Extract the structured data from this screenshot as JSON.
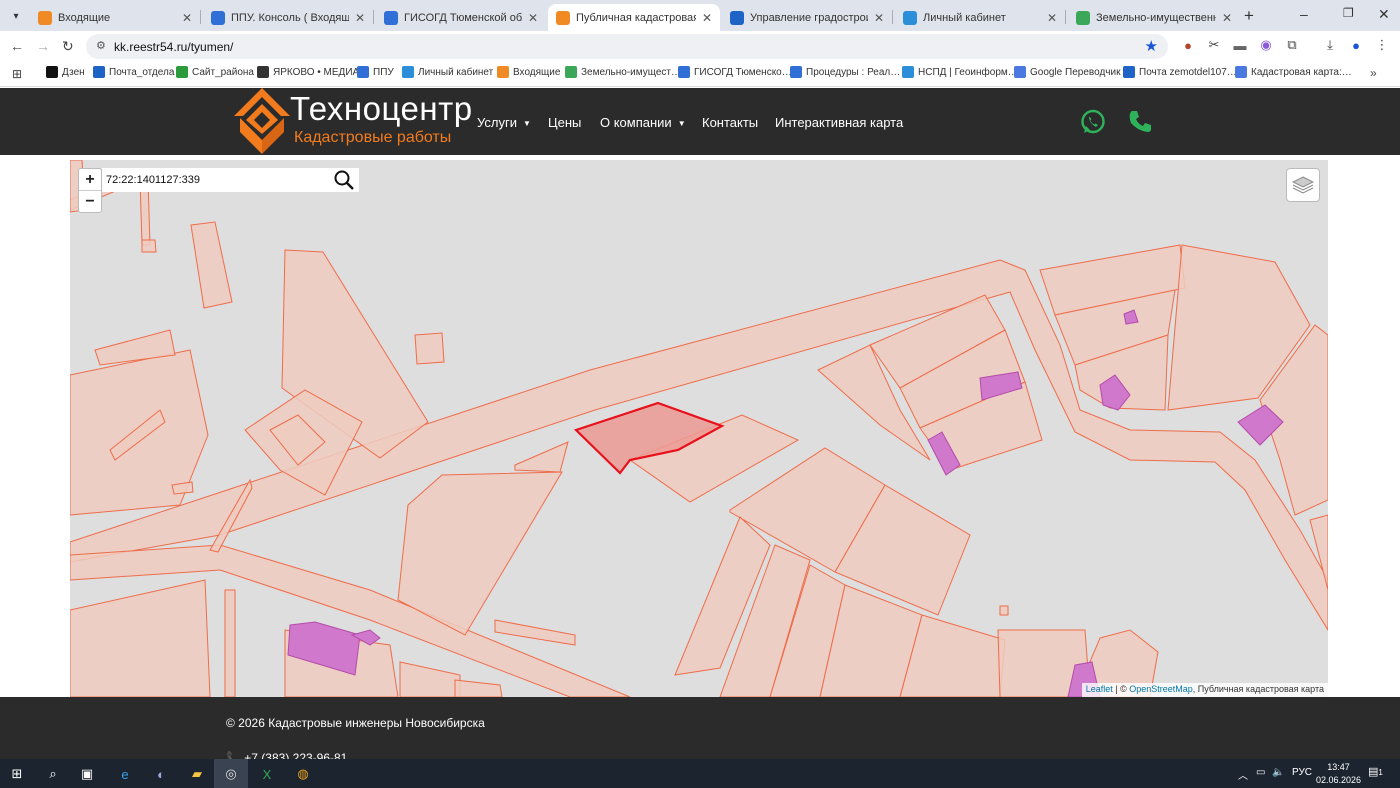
{
  "browser": {
    "tabs": [
      {
        "title": "Входящие",
        "color": "#f08a24"
      },
      {
        "title": "ППУ. Консоль ( Входящие )",
        "color": "#2f6fd6"
      },
      {
        "title": "ГИСОГД Тюменской области",
        "color": "#2f6fd6"
      },
      {
        "title": "Публичная кадастровая карта",
        "color": "#f08a24"
      },
      {
        "title": "Управление градостроительн…",
        "color": "#1e63c6"
      },
      {
        "title": "Личный кабинет",
        "color": "#2a8fd8"
      },
      {
        "title": "Земельно-имущественный ко…",
        "color": "#3aa858"
      }
    ],
    "active_tab": 3,
    "url": "kk.reestr54.ru/tyumen/",
    "bookmarks": [
      {
        "label": "Дзен",
        "color": "#111111"
      },
      {
        "label": "Почта_отдела",
        "color": "#1e63c6"
      },
      {
        "label": "Сайт_района",
        "color": "#2b9a3a"
      },
      {
        "label": "ЯРКОВО • МЕДИА",
        "color": "#333333"
      },
      {
        "label": "ППУ",
        "color": "#2f6fd6"
      },
      {
        "label": "Личный кабинет",
        "color": "#2a8fd8"
      },
      {
        "label": "Входящие",
        "color": "#f08a24"
      },
      {
        "label": "Земельно-имущест…",
        "color": "#3aa858"
      },
      {
        "label": "ГИСОГД Тюменско…",
        "color": "#2f6fd6"
      },
      {
        "label": "Процедуры : Реал…",
        "color": "#2f6fd6"
      },
      {
        "label": "НСПД | Геоинформ…",
        "color": "#2a8fd8"
      },
      {
        "label": "Google Переводчик",
        "color": "#4a78e0"
      },
      {
        "label": "Почта zemotdel107…",
        "color": "#1e63c6"
      },
      {
        "label": "Кадастровая карта:…",
        "color": "#4a78e0"
      }
    ]
  },
  "site": {
    "logo_name": "Техноцентр",
    "logo_subtitle": "Кадастровые работы",
    "brand_color": "#f27b1e",
    "nav": {
      "services": "Услуги",
      "prices": "Цены",
      "about": "О компании",
      "contacts": "Контакты",
      "map": "Интерактивная карта"
    }
  },
  "map": {
    "search_value": "72:22:1401127:339",
    "zoom_in": "+",
    "zoom_out": "−",
    "attribution_leaflet": "Leaflet",
    "attribution_sep": " | © ",
    "attribution_osm": "OpenStreetMap",
    "attribution_rest": ", Публичная кадастровая карта",
    "parcel_color": "#ef6c4a",
    "building_color": "#d078cc",
    "selected_color": "#e8101a"
  },
  "footer": {
    "copyright": "© 2026 Кадастровые инженеры Новосибирска",
    "phone": "+7 (383) 223-96-81"
  },
  "taskbar": {
    "lang": "РУС",
    "time": "13:47",
    "date": "02.06.2026",
    "notifications": "1"
  }
}
